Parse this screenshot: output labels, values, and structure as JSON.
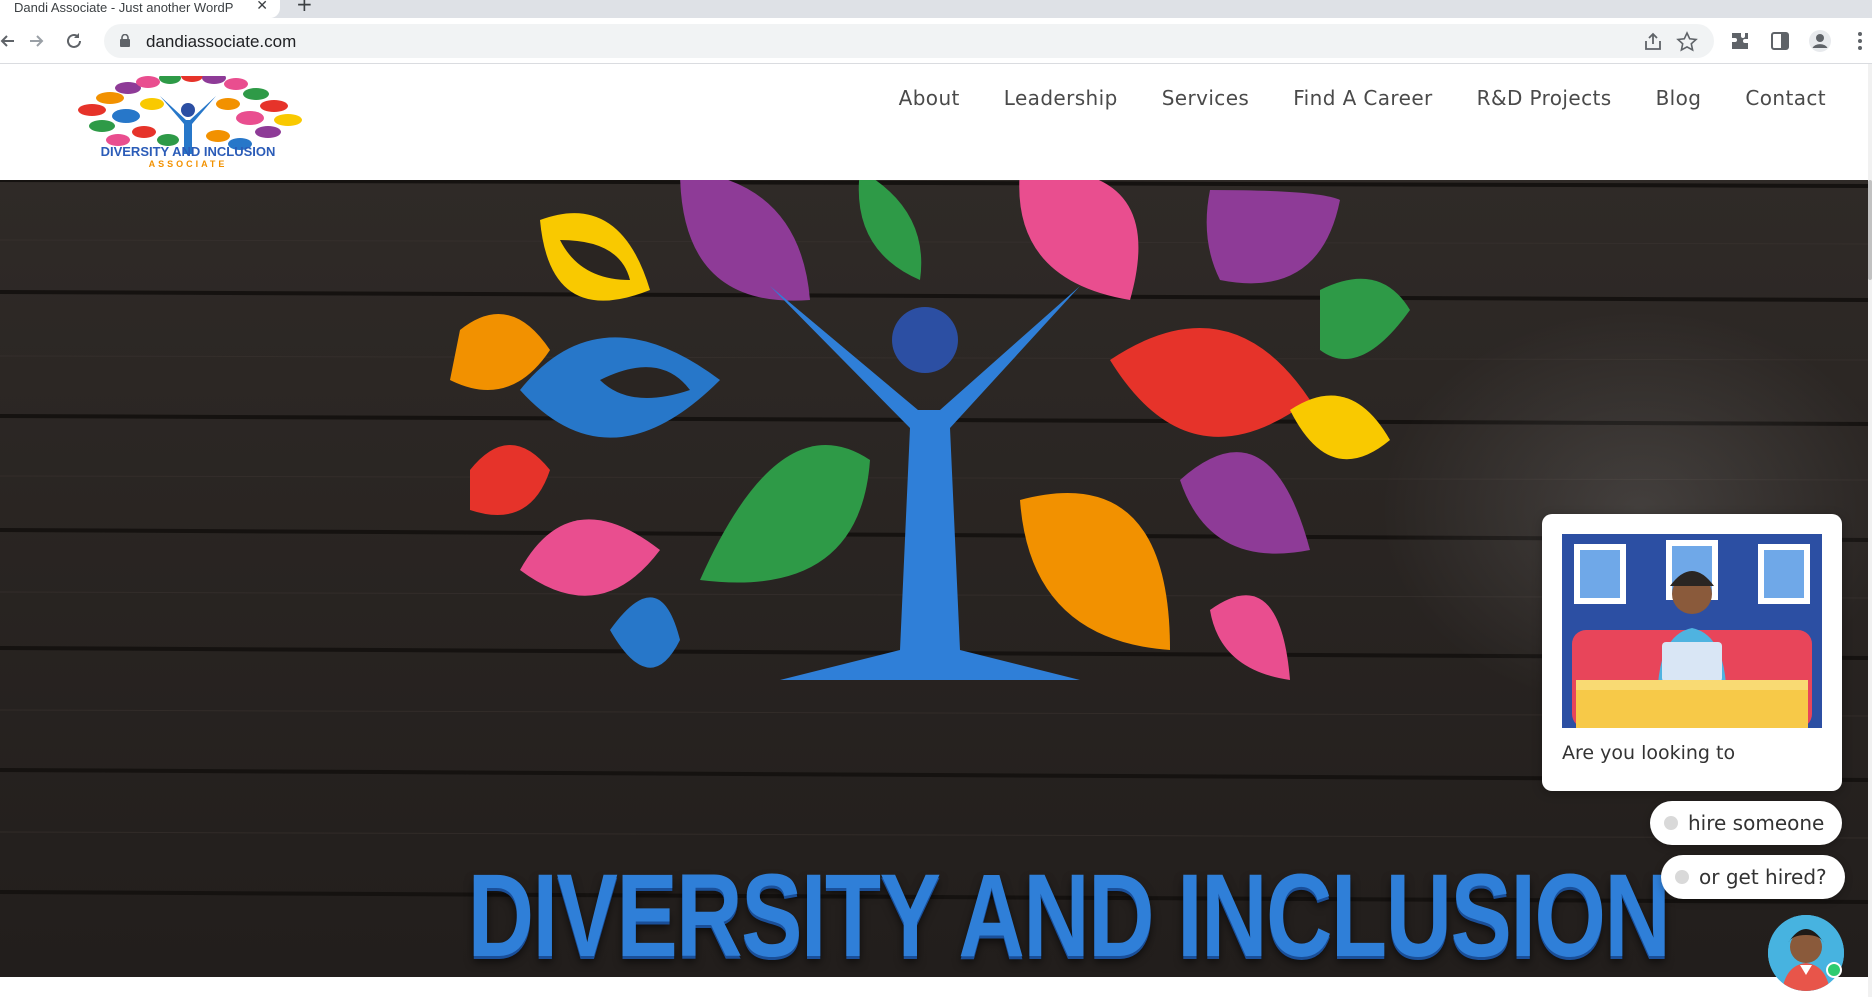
{
  "browser": {
    "tab_title": "Dandi Associate - Just another WordPress site",
    "url": "dandiassociate.com"
  },
  "icons": [
    "back-icon",
    "forward-icon",
    "reload-icon",
    "lock-icon",
    "share-icon",
    "star-icon",
    "extensions-icon",
    "side-panel-icon",
    "profile-icon",
    "menu-icon",
    "close-icon",
    "new-tab-icon"
  ],
  "site": {
    "logo_text": "DIVERSITY AND INCLUSION",
    "logo_subtext": "ASSOCIATE",
    "nav": [
      "About",
      "Leadership",
      "Services",
      "Find A Career",
      "R&D Projects",
      "Blog",
      "Contact"
    ]
  },
  "hero": {
    "title": "DIVERSITY AND INCLUSION"
  },
  "chat": {
    "prompt": "Are you looking to",
    "options": [
      "hire someone",
      "or get hired?"
    ]
  },
  "colors": {
    "brand_blue": "#2f7fd8",
    "hero_background": "#2a2522",
    "online_green": "#2ecc71"
  }
}
